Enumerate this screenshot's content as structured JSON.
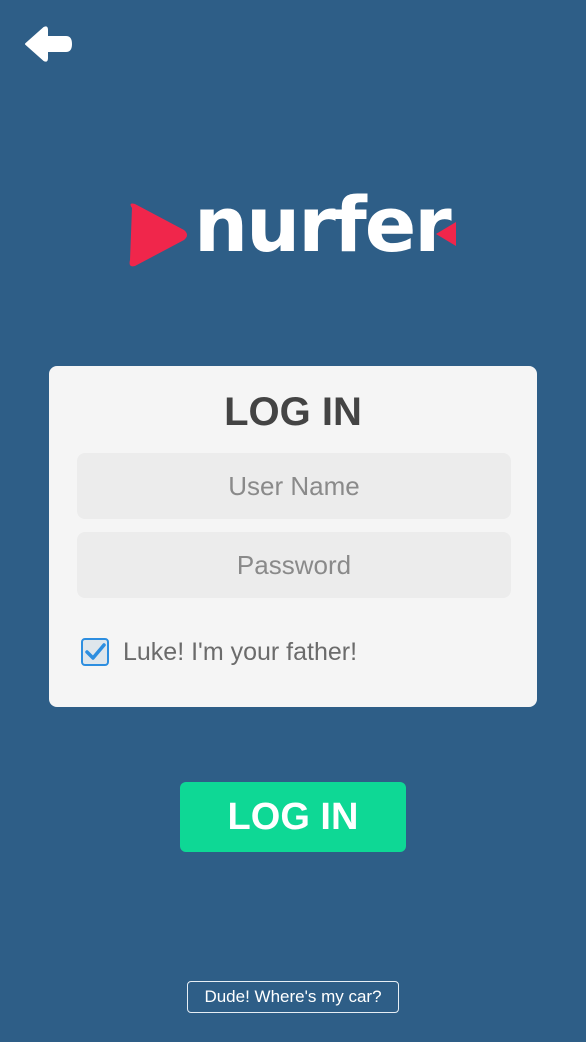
{
  "header": {
    "back_icon": "arrow-left-icon"
  },
  "logo": {
    "wordmark": "nurfer",
    "brand_color": "#f0264b",
    "play_icon": "play-triangle-icon",
    "end_icon": "small-triangle-icon"
  },
  "login_card": {
    "title": "LOG IN",
    "username": {
      "placeholder": "User Name",
      "value": ""
    },
    "password": {
      "placeholder": "Password",
      "value": ""
    },
    "remember": {
      "label": "Luke! I'm your father!",
      "checked": true
    }
  },
  "login_button": {
    "label": "LOG IN",
    "color": "#0ed895"
  },
  "footer": {
    "link_label": "Dude! Where's my car?"
  },
  "colors": {
    "background": "#2e5e87",
    "card": "#f5f5f5",
    "field": "#ececec",
    "checkbox_accent": "#2d8ee0"
  }
}
